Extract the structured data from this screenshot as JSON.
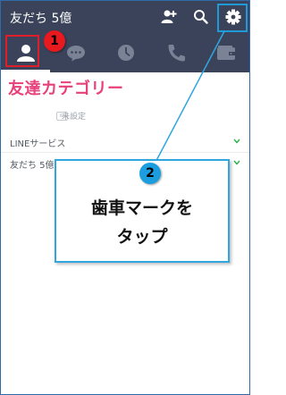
{
  "header": {
    "title": "友だち 5億",
    "icons": [
      "add-friend-icon",
      "search-icon",
      "gear-icon"
    ]
  },
  "tabs": [
    {
      "name": "friends",
      "icon": "person-icon",
      "active": true
    },
    {
      "name": "chats",
      "icon": "chat-bubble-icon",
      "active": false
    },
    {
      "name": "timeline",
      "icon": "clock-icon",
      "active": false
    },
    {
      "name": "calls",
      "icon": "phone-icon",
      "active": false
    },
    {
      "name": "wallet",
      "icon": "wallet-icon",
      "active": false
    }
  ],
  "annotations": {
    "category_label": "友達カテゴリー",
    "badge_1": "1",
    "badge_2": "2",
    "callout_line1": "歯車マークを",
    "callout_line2": "タップ"
  },
  "profile": {
    "status": "未設定"
  },
  "sections": [
    {
      "label": "LINEサービス"
    },
    {
      "label": "友だち 5億"
    }
  ],
  "colors": {
    "header_bg": "#3a4359",
    "accent_pink": "#e8407a",
    "highlight_red": "#e01e2a",
    "highlight_blue": "#1e9ad8",
    "chevron_green": "#29b34a"
  }
}
